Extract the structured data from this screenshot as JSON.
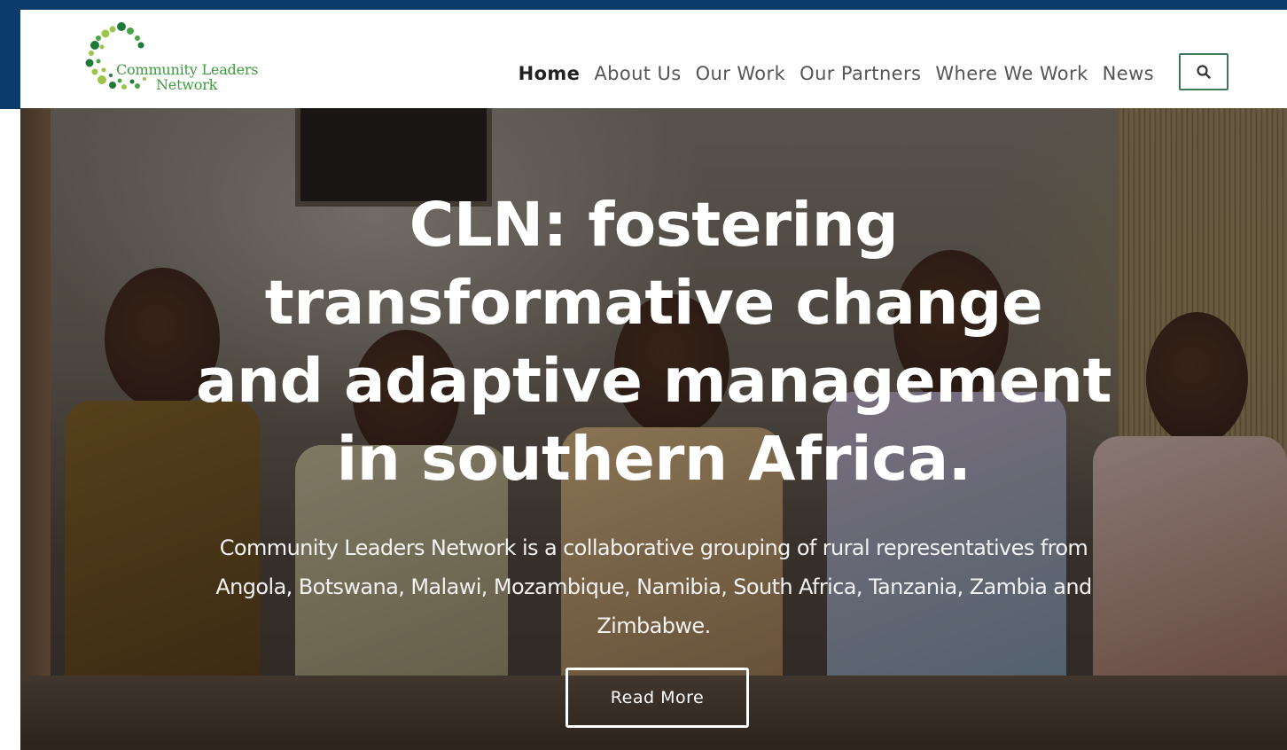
{
  "brand": {
    "line1": "Community Leaders",
    "line2": "Network",
    "logo_icon": "dot-swirl-logo-icon",
    "colors": {
      "dark_green": "#1f7a3a",
      "mid_green": "#4aa547",
      "light_green": "#9cc44a",
      "frame_blue": "#0b3a6d"
    }
  },
  "nav": {
    "items": [
      {
        "label": "Home",
        "active": true
      },
      {
        "label": "About Us",
        "active": false
      },
      {
        "label": "Our Work",
        "active": false
      },
      {
        "label": "Our Partners",
        "active": false
      },
      {
        "label": "Where We Work",
        "active": false
      },
      {
        "label": "News",
        "active": false
      }
    ],
    "search_icon": "search-icon"
  },
  "hero": {
    "title": "CLN: fostering transformative change and adaptive management in southern Africa.",
    "description": "Community Leaders Network is a collaborative grouping of rural representatives from Angola, Botswana, Malawi, Mozambique, Namibia, South Africa, Tanzania, Zambia and Zimbabwe.",
    "button_label": "Read More",
    "background": "photo-children-sitting"
  }
}
